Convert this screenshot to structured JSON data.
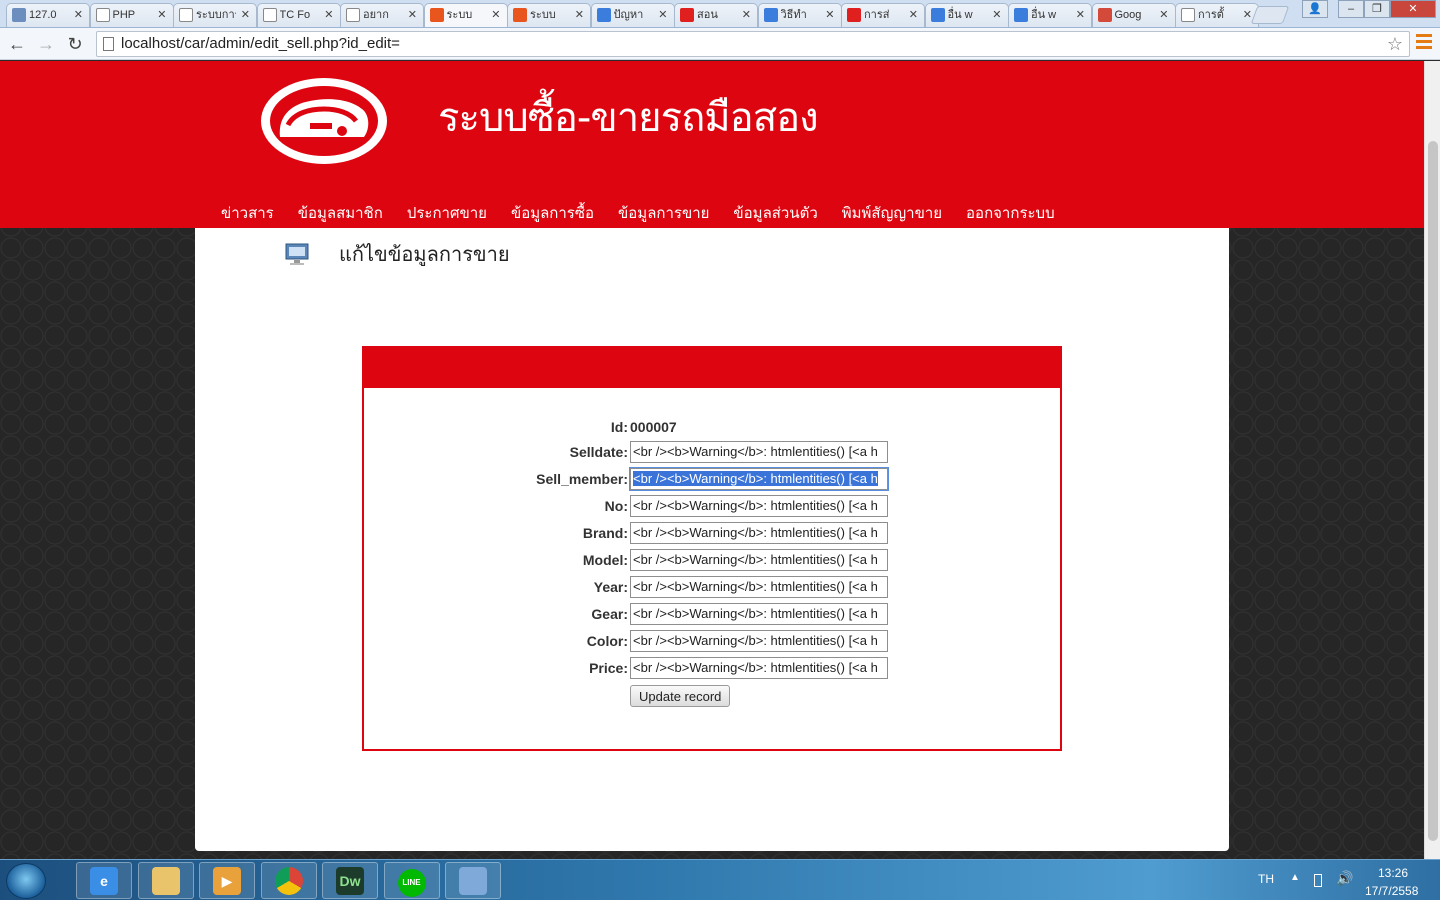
{
  "browser": {
    "tabs": [
      {
        "label": "127.0",
        "icon": "pma-icon",
        "color": "#6c8ebf"
      },
      {
        "label": "PHP",
        "icon": "page-icon",
        "color": "#ffffff"
      },
      {
        "label": "ระบบการ",
        "icon": "page-icon",
        "color": "#ffffff"
      },
      {
        "label": "TC Fo",
        "icon": "page-icon",
        "color": "#ffffff"
      },
      {
        "label": "อยาก",
        "icon": "page-icon",
        "color": "#ffffff"
      },
      {
        "label": "ระบบ",
        "icon": "xampp-icon",
        "color": "#e8551d",
        "active": true
      },
      {
        "label": "ระบบ",
        "icon": "xampp-icon",
        "color": "#e8551d"
      },
      {
        "label": "ปัญหา",
        "icon": "blogger-icon",
        "color": "#3b7ddd"
      },
      {
        "label": "สอน",
        "icon": "youtube-icon",
        "color": "#e01f1f"
      },
      {
        "label": "วิธีทำ",
        "icon": "google-icon",
        "color": "#3b7ddd"
      },
      {
        "label": "การส่",
        "icon": "youtube-icon",
        "color": "#e01f1f"
      },
      {
        "label": "อื่น w",
        "icon": "google-icon",
        "color": "#3b7ddd"
      },
      {
        "label": "อื่น w",
        "icon": "google-icon",
        "color": "#3b7ddd"
      },
      {
        "label": "Goog",
        "icon": "gplus-icon",
        "color": "#d44a3a"
      },
      {
        "label": "การตั้",
        "icon": "page-icon",
        "color": "#ffffff"
      }
    ],
    "url": "localhost/car/admin/edit_sell.php?id_edit="
  },
  "site": {
    "title": "ระบบซื้อ-ขายรถมือสอง",
    "nav": [
      "ข่าวสาร",
      "ข้อมูลสมาชิก",
      "ประกาศขาย",
      "ข้อมูลการซื้อ",
      "ข้อมูลการขาย",
      "ข้อมูลส่วนตัว",
      "พิมพ์สัญญาขาย",
      "ออกจากระบบ"
    ],
    "brand_color": "#dd0610"
  },
  "page": {
    "heading": "แก้ไขข้อมูลการขาย"
  },
  "form": {
    "id_label": "Id:",
    "id_value": "000007",
    "fields": [
      {
        "label": "Selldate:",
        "value": "<br /><b>Warning</b>:  htmlentities() [<a h"
      },
      {
        "label": "Sell_member:",
        "value": "<br /><b>Warning</b>:  htmlentities() [<a h",
        "selected": true
      },
      {
        "label": "No:",
        "value": "<br /><b>Warning</b>:  htmlentities() [<a h"
      },
      {
        "label": "Brand:",
        "value": "<br /><b>Warning</b>:  htmlentities() [<a h"
      },
      {
        "label": "Model:",
        "value": "<br /><b>Warning</b>:  htmlentities() [<a h"
      },
      {
        "label": "Year:",
        "value": "<br /><b>Warning</b>:  htmlentities() [<a h"
      },
      {
        "label": "Gear:",
        "value": "<br /><b>Warning</b>:  htmlentities() [<a h"
      },
      {
        "label": "Color:",
        "value": "<br /><b>Warning</b>:  htmlentities() [<a h"
      },
      {
        "label": "Price:",
        "value": "<br /><b>Warning</b>:  htmlentities() [<a h"
      }
    ],
    "submit_label": "Update record"
  },
  "taskbar": {
    "apps": [
      {
        "name": "internet-explorer-icon",
        "glyph": "e"
      },
      {
        "name": "file-explorer-icon",
        "glyph": ""
      },
      {
        "name": "media-player-icon",
        "glyph": "▶"
      },
      {
        "name": "chrome-icon",
        "glyph": ""
      },
      {
        "name": "dreamweaver-icon",
        "glyph": "Dw"
      },
      {
        "name": "line-icon",
        "glyph": "LINE"
      },
      {
        "name": "paint-icon",
        "glyph": ""
      }
    ],
    "language": "TH",
    "time": "13:26",
    "date": "17/7/2558"
  }
}
